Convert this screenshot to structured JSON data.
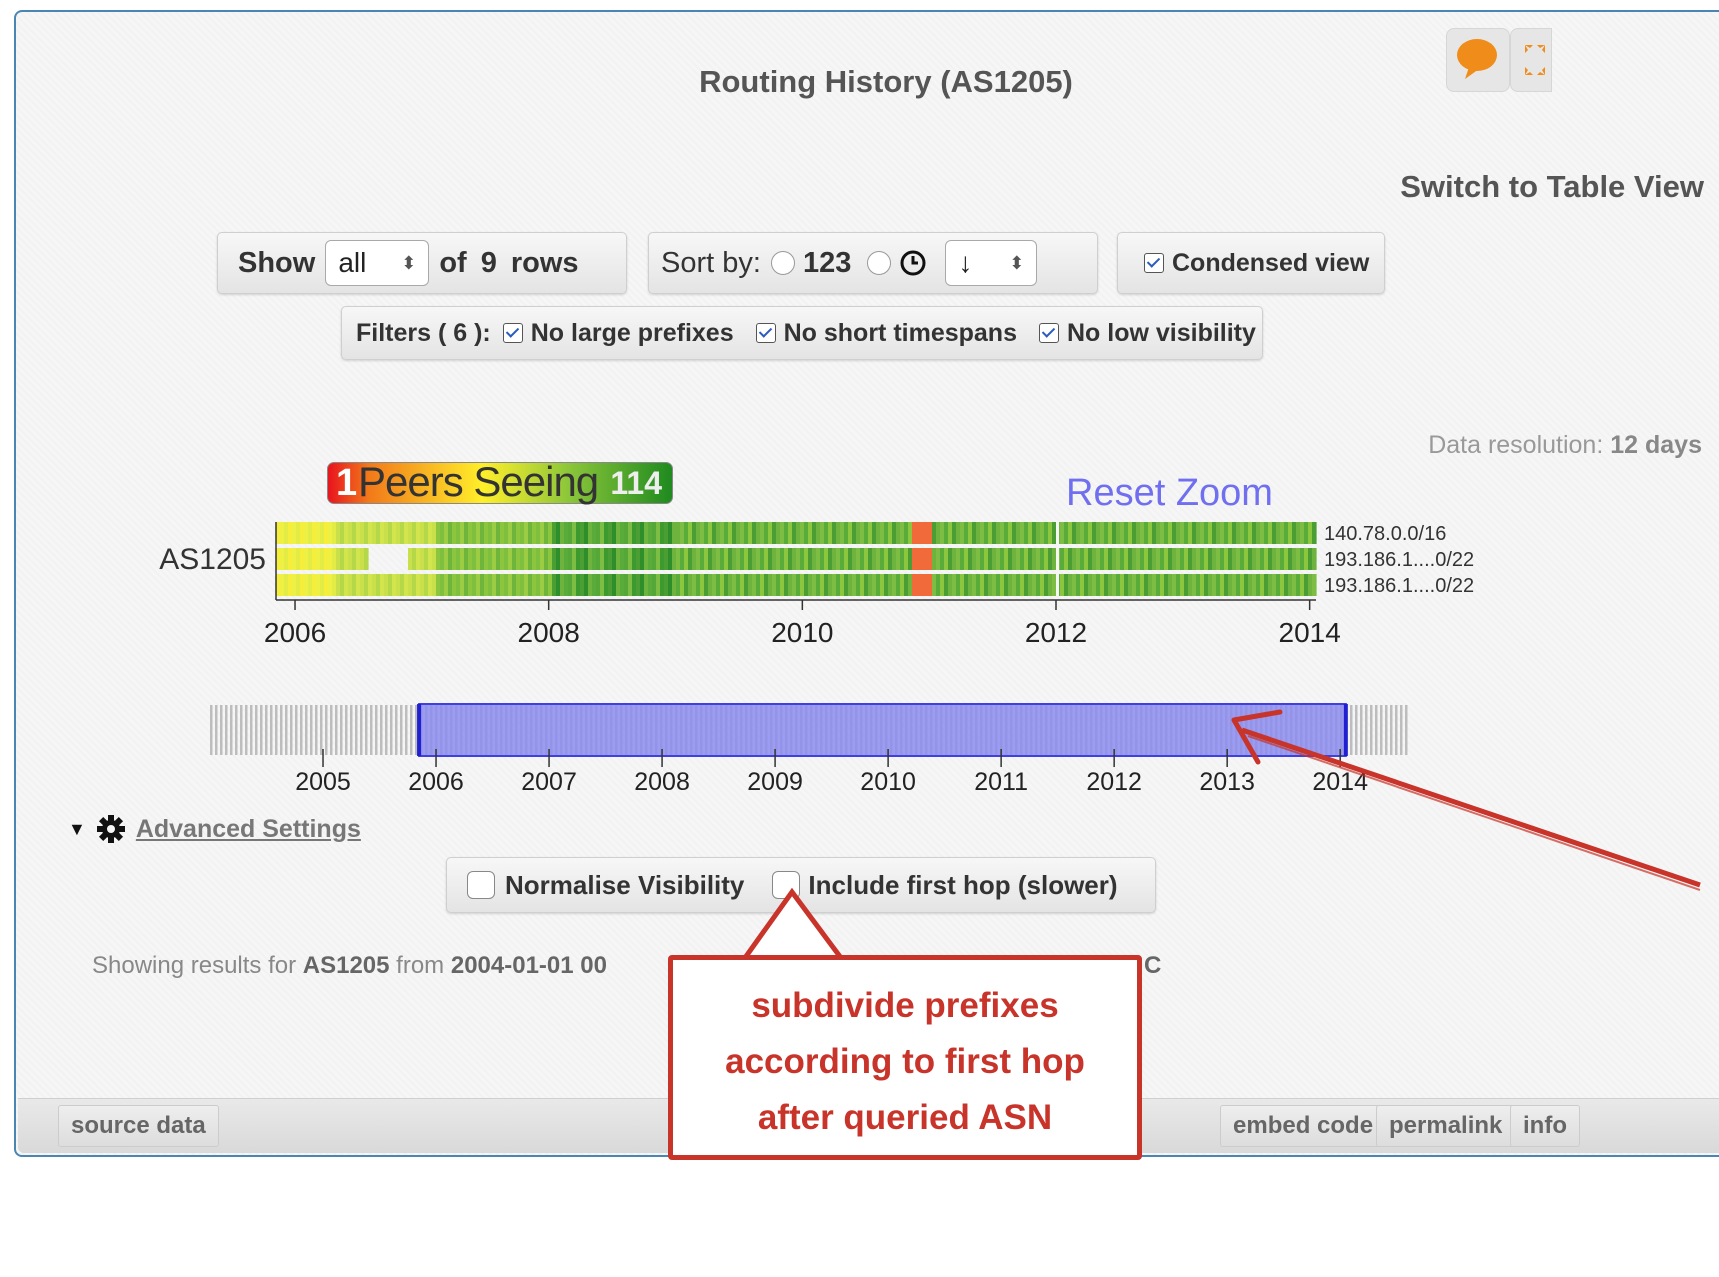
{
  "widget": {
    "title": "Routing History (AS1205)",
    "toggle_label": "Switch to Table View",
    "icons": {
      "comment": "speech-bubble-icon",
      "fullscreen": "expand-icon"
    }
  },
  "controls": {
    "show_label": "Show",
    "rows_select": "all",
    "of_label": "of",
    "row_count": "9",
    "rows_label": "rows",
    "sort_label": "Sort by:",
    "sort_option_number": "123",
    "sort_option_time_icon": "clock-icon",
    "sort_direction": "↓",
    "condensed_label": "Condensed view",
    "filters_label": "Filters ( 6 ):",
    "filter_large_prefixes": "No large prefixes",
    "filter_short_timespans": "No short timespans",
    "filter_low_visibility": "No low visibility"
  },
  "data_resolution": {
    "label": "Data resolution:",
    "value": "12 days"
  },
  "legend": {
    "min": "1",
    "label": "Peers Seeing",
    "max": "114"
  },
  "reset_zoom": "Reset Zoom",
  "chart_data": {
    "type": "heatmap",
    "y_label": "AS1205",
    "rows": [
      "140.78.0.0/16",
      "193.186.1....0/22",
      "193.186.1....0/22"
    ],
    "x_ticks": [
      "2006",
      "2008",
      "2010",
      "2012",
      "2014"
    ],
    "x_range": [
      2005.85,
      2014.05
    ],
    "color_scale": [
      "#e8141e",
      "#ffef2a",
      "#1f8a1f"
    ],
    "navigator": {
      "ticks": [
        "2005",
        "2006",
        "2007",
        "2008",
        "2009",
        "2010",
        "2011",
        "2012",
        "2013",
        "2014"
      ],
      "range": [
        2004.0,
        2014.6
      ],
      "selected": [
        2005.85,
        2014.05
      ]
    }
  },
  "advanced": {
    "toggle_label": "Advanced Settings",
    "normalise_label": "Normalise Visibility",
    "first_hop_label": "Include first hop (slower)"
  },
  "status": {
    "prefix": "Showing results for",
    "asn": "AS1205",
    "from_label": "from",
    "start": "2004-01-01 00",
    "tail": "C"
  },
  "footer": {
    "source_data": "source data",
    "embed_code": "embed code",
    "permalink": "permalink",
    "info": "info"
  },
  "annotation": {
    "lines": [
      "subdivide prefixes",
      "according to first hop",
      "after queried ASN"
    ],
    "color": "#c8332a"
  }
}
